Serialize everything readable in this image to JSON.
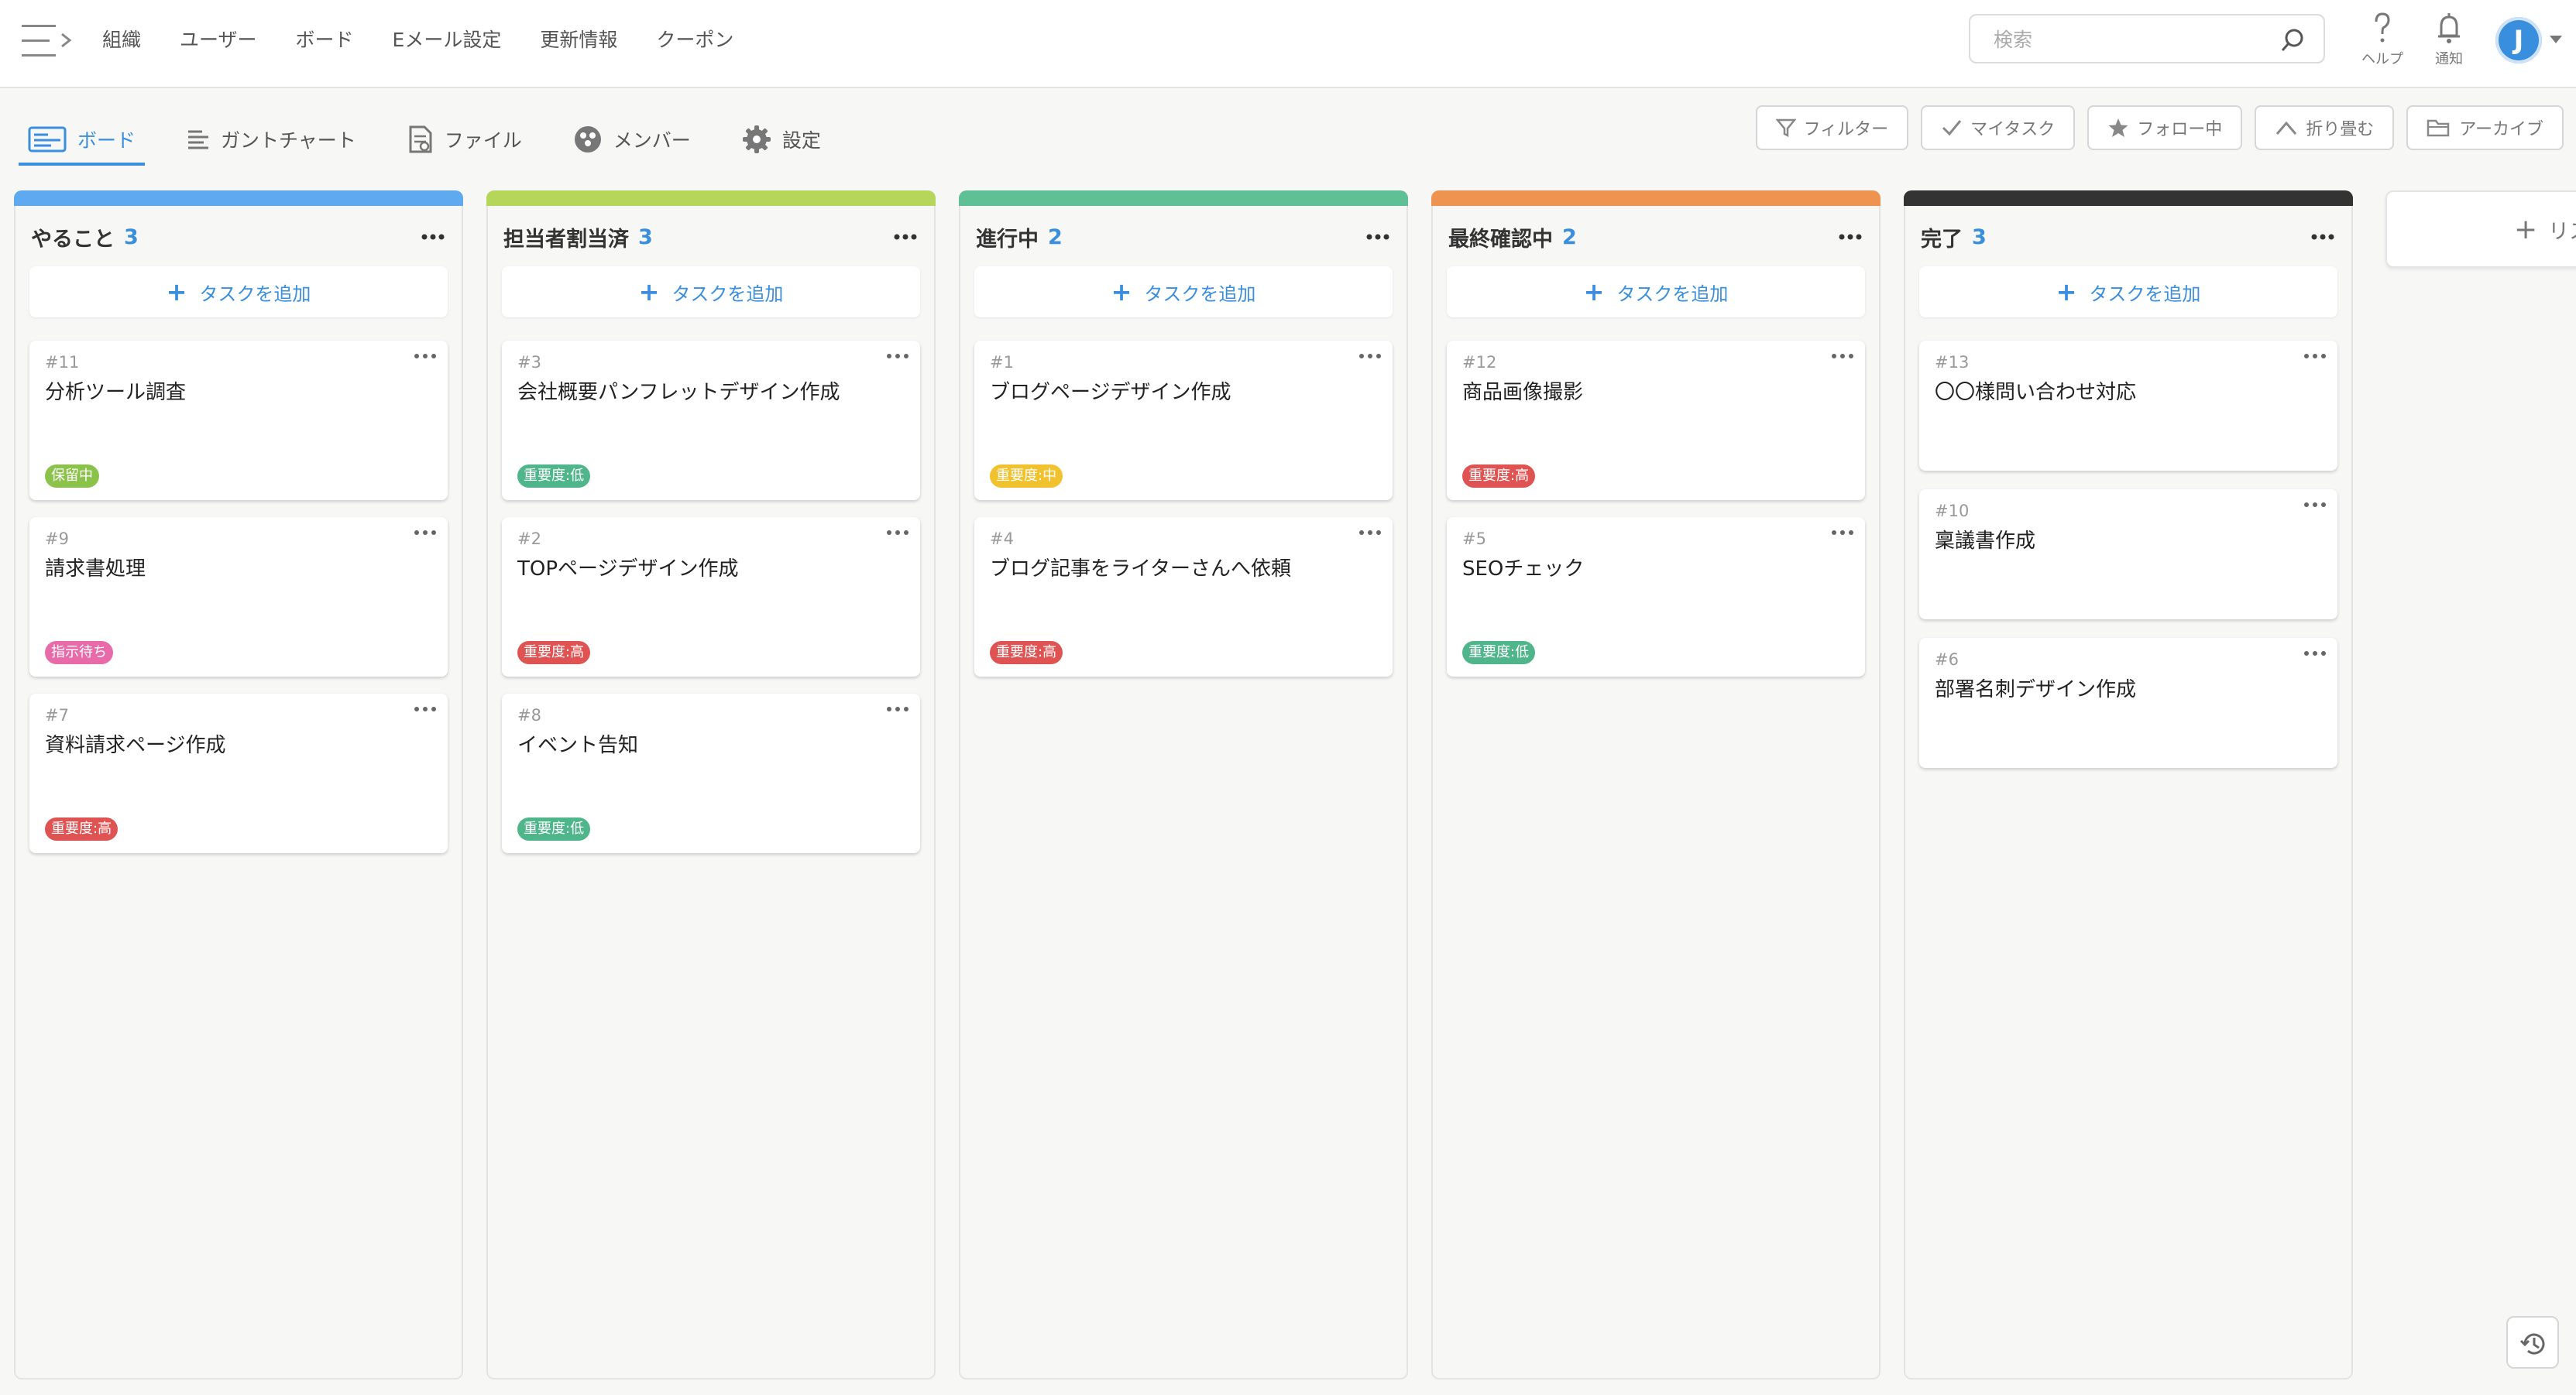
{
  "nav": {
    "links": [
      "組織",
      "ユーザー",
      "ボード",
      "Eメール設定",
      "更新情報",
      "クーポン"
    ],
    "search_placeholder": "検索",
    "help_label": "ヘルプ",
    "notify_label": "通知",
    "avatar_initial": "J"
  },
  "subtabs": [
    "ボード",
    "ガントチャート",
    "ファイル",
    "メンバー",
    "設定"
  ],
  "actions": [
    "フィルター",
    "マイタスク",
    "フォロー中",
    "折り畳む",
    "アーカイブ"
  ],
  "add_task_label": "タスクを追加",
  "add_list_label": "リス",
  "colors": {
    "accent": "#3a8ede",
    "tag_hold": "#8bc34a",
    "tag_wait": "#e86aa8",
    "tag_high": "#e05353",
    "tag_low": "#4fb58a",
    "tag_mid": "#f2c12e"
  },
  "columns": [
    {
      "title": "やること",
      "count": "3",
      "color": "#5ea9f0",
      "cards": [
        {
          "id": "#11",
          "title": "分析ツール調査",
          "tag": "保留中",
          "tag_color": "#8bc34a"
        },
        {
          "id": "#9",
          "title": "請求書処理",
          "tag": "指示待ち",
          "tag_color": "#e86aa8"
        },
        {
          "id": "#7",
          "title": "資料請求ページ作成",
          "tag": "重要度:高",
          "tag_color": "#e05353"
        }
      ]
    },
    {
      "title": "担当者割当済",
      "count": "3",
      "color": "#b5d65a",
      "cards": [
        {
          "id": "#3",
          "title": "会社概要パンフレットデザイン作成",
          "tag": "重要度:低",
          "tag_color": "#4fb58a"
        },
        {
          "id": "#2",
          "title": "TOPページデザイン作成",
          "tag": "重要度:高",
          "tag_color": "#e05353"
        },
        {
          "id": "#8",
          "title": "イベント告知",
          "tag": "重要度:低",
          "tag_color": "#4fb58a"
        }
      ]
    },
    {
      "title": "進行中",
      "count": "2",
      "color": "#5fbf96",
      "cards": [
        {
          "id": "#1",
          "title": "ブログページデザイン作成",
          "tag": "重要度:中",
          "tag_color": "#f2c12e"
        },
        {
          "id": "#4",
          "title": "ブログ記事をライターさんへ依頼",
          "tag": "重要度:高",
          "tag_color": "#e05353"
        }
      ]
    },
    {
      "title": "最終確認中",
      "count": "2",
      "color": "#ef9450",
      "cards": [
        {
          "id": "#12",
          "title": "商品画像撮影",
          "tag": "重要度:高",
          "tag_color": "#e05353"
        },
        {
          "id": "#5",
          "title": "SEOチェック",
          "tag": "重要度:低",
          "tag_color": "#4fb58a"
        }
      ]
    },
    {
      "title": "完了",
      "count": "3",
      "color": "#333333",
      "cards": [
        {
          "id": "#13",
          "title": "〇〇様問い合わせ対応",
          "tag": "",
          "tag_color": ""
        },
        {
          "id": "#10",
          "title": "稟議書作成",
          "tag": "",
          "tag_color": ""
        },
        {
          "id": "#6",
          "title": "部署名刺デザイン作成",
          "tag": "",
          "tag_color": ""
        }
      ]
    }
  ]
}
